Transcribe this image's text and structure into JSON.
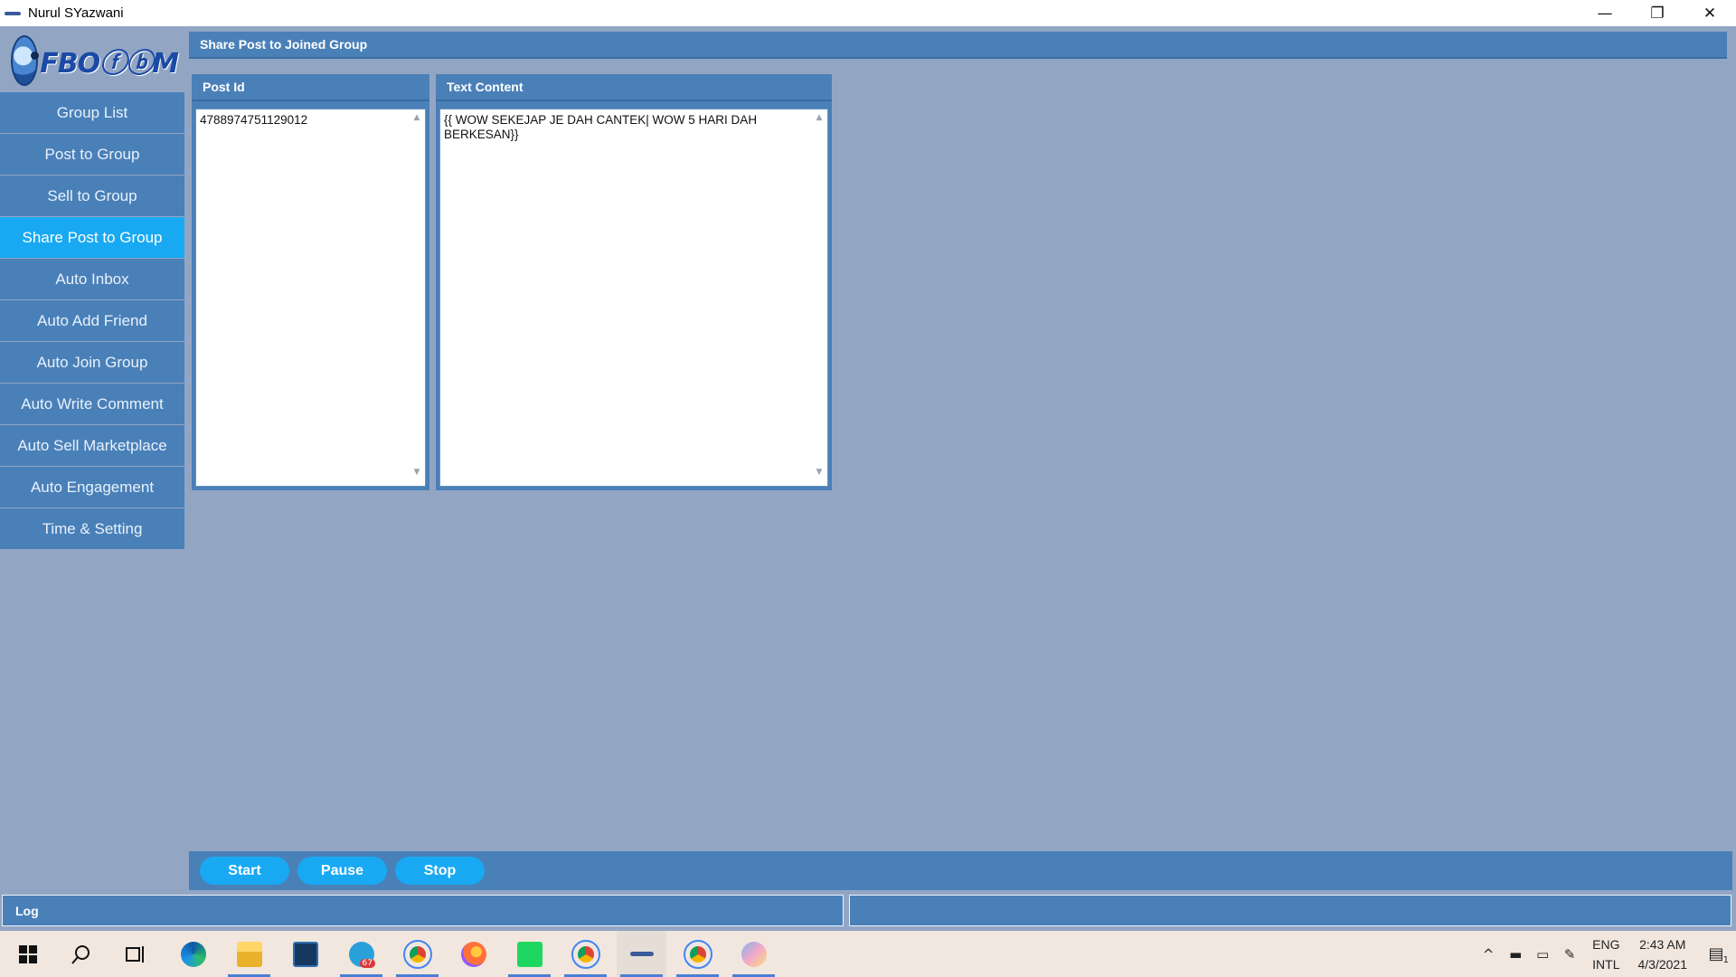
{
  "window": {
    "title": "Nurul SYazwani",
    "minimize_symbol": "—",
    "restore_symbol": "❐",
    "close_symbol": "✕"
  },
  "logo": {
    "text": "FBOⓕⓑM",
    "icon": "fboom-mascot-icon"
  },
  "sidebar": {
    "items": [
      {
        "label": "Group List",
        "active": false
      },
      {
        "label": "Post to Group",
        "active": false
      },
      {
        "label": "Sell to Group",
        "active": false
      },
      {
        "label": "Share Post to Group",
        "active": true
      },
      {
        "label": "Auto Inbox",
        "active": false
      },
      {
        "label": "Auto Add Friend",
        "active": false
      },
      {
        "label": "Auto Join Group",
        "active": false
      },
      {
        "label": "Auto Write Comment",
        "active": false
      },
      {
        "label": "Auto Sell Marketplace",
        "active": false
      },
      {
        "label": "Auto Engagement",
        "active": false
      },
      {
        "label": "Time & Setting",
        "active": false
      }
    ]
  },
  "main": {
    "header": "Share Post to Joined Group",
    "post_id_panel": {
      "header": "Post Id",
      "value": "4788974751129012"
    },
    "text_panel": {
      "header": "Text Content",
      "value": "{{ WOW SEKEJAP JE DAH CANTEK| WOW 5 HARI DAH BERKESAN}}"
    }
  },
  "actions": {
    "start": "Start",
    "pause": "Pause",
    "stop": "Stop"
  },
  "log": {
    "label": "Log"
  },
  "taskbar": {
    "icons": [
      "windows-start-icon",
      "search-icon",
      "task-view-icon",
      "edge-icon",
      "file-explorer-icon",
      "dell-icon",
      "telegram-icon",
      "chrome-profile-icon",
      "firefox-icon",
      "spotify-icon",
      "chrome-profile-2-icon",
      "fboom-app-icon",
      "chrome-icon",
      "paint-icon"
    ],
    "telegram_badge": "67",
    "language": {
      "line1": "ENG",
      "line2": "INTL"
    },
    "clock": {
      "time": "2:43 AM",
      "date": "4/3/2021"
    },
    "notification_count": "1"
  },
  "colors": {
    "background": "#92a6c4",
    "panel": "#4a80b8",
    "accent": "#18a9f2"
  }
}
